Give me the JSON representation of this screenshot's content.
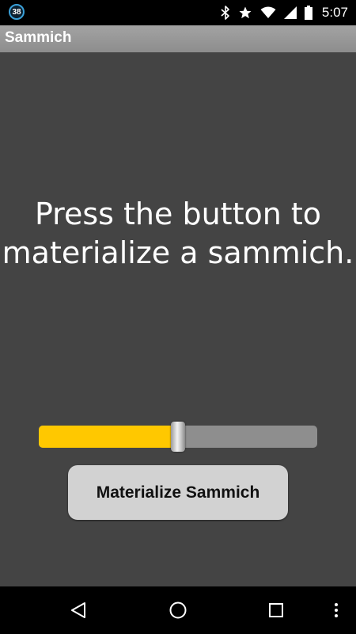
{
  "status_bar": {
    "notification_count": "38",
    "time": "5:07",
    "icons": [
      "bluetooth-icon",
      "star-icon",
      "wifi-icon",
      "signal-icon",
      "battery-icon"
    ]
  },
  "action_bar": {
    "title": "Sammich"
  },
  "main": {
    "prompt_line1": "Press the button to",
    "prompt_line2": "materialize a sammich.",
    "slider_value": 0.5,
    "button_label": "Materialize Sammich"
  },
  "nav_bar": {
    "icons": [
      "back-icon",
      "home-icon",
      "recents-icon",
      "overflow-menu-icon"
    ]
  },
  "colors": {
    "background": "#444444",
    "slider_fill": "#ffc800",
    "slider_track": "#8e8e8e",
    "button": "#d2d2d2"
  }
}
